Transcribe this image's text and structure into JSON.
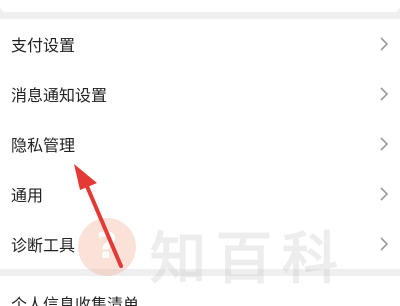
{
  "settings": {
    "items": [
      {
        "label": "支付设置"
      },
      {
        "label": "消息通知设置"
      },
      {
        "label": "隐私管理"
      },
      {
        "label": "通用"
      },
      {
        "label": "诊断工具"
      }
    ],
    "chevron_icon": "chevron-right-icon"
  },
  "bottom": {
    "partial_label": "个人信息收集清单"
  },
  "annotation": {
    "color": "#e53935",
    "target": "隐私管理"
  },
  "watermark": {
    "logo_mark": "?",
    "text": "知百科",
    "color": "#f0a888"
  }
}
